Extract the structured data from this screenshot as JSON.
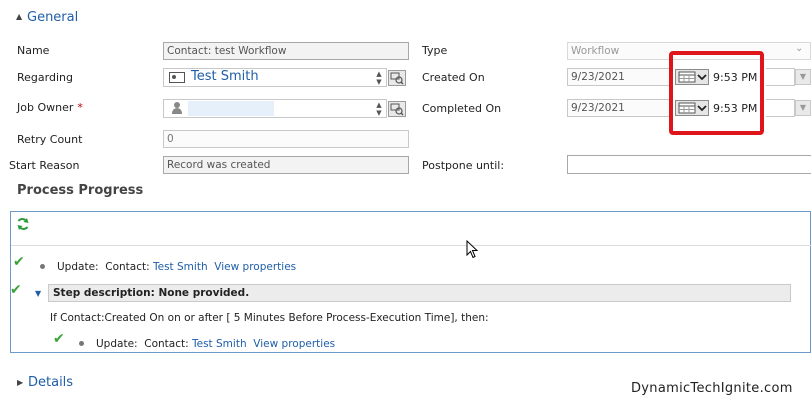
{
  "general": {
    "title": "General"
  },
  "form": {
    "name_label": "Name",
    "name_value": "Contact: test Workflow",
    "regarding_label": "Regarding",
    "regarding_value": "Test Smith",
    "job_owner_label": "Job Owner",
    "required_mark": "*",
    "retry_label": "Retry Count",
    "retry_value": "0",
    "start_reason_label": "Start Reason",
    "start_reason_value": "Record was created",
    "type_label": "Type",
    "type_value": "Workflow",
    "created_on_label": "Created On",
    "created_on_date": "9/23/2021",
    "created_on_time": "9:53 PM",
    "completed_on_label": "Completed On",
    "completed_on_date": "9/23/2021",
    "completed_on_time": "9:53 PM",
    "postpone_label": "Postpone until:",
    "postpone_value": ""
  },
  "progress": {
    "title": "Process Progress",
    "step1_action": "Update:",
    "step1_entity": "Contact:",
    "step1_link": "Test Smith",
    "step1_props": "View properties",
    "step_description": "Step description: None provided.",
    "condition": "If Contact:Created On on or after [ 5 Minutes Before Process-Execution Time], then:",
    "step2_action": "Update:",
    "step2_entity": "Contact:",
    "step2_link": "Test Smith",
    "step2_props": "View properties"
  },
  "details": {
    "title": "Details"
  },
  "watermark": "DynamicTechIgnite.com",
  "colors": {
    "accent": "#1f5ea8",
    "highlight": "#e0141b",
    "check": "#3aa33a"
  }
}
